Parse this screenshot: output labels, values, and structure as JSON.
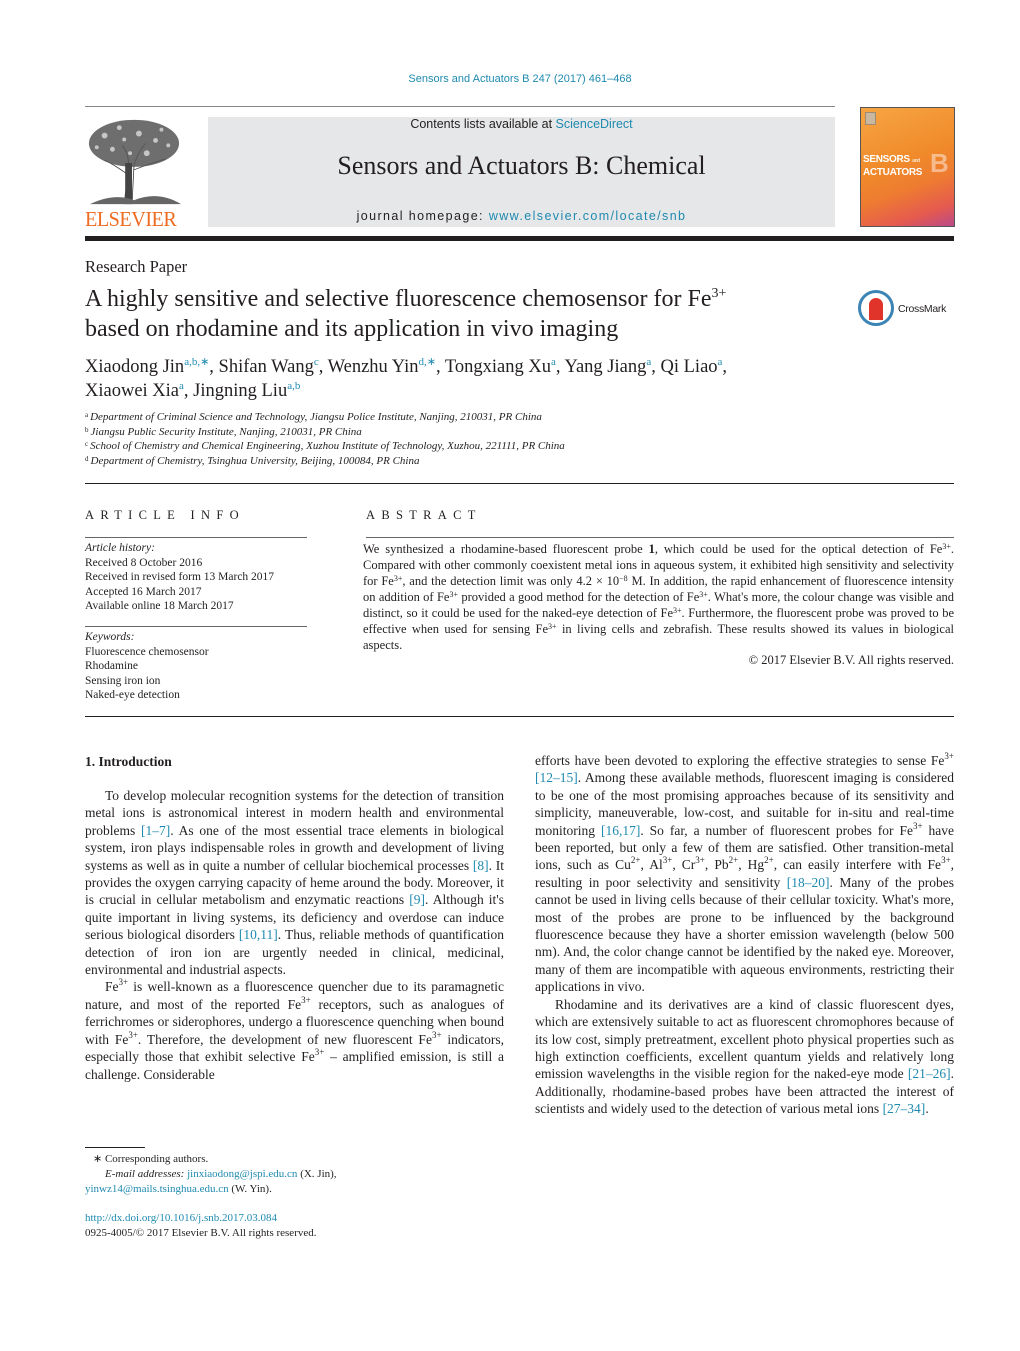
{
  "header": {
    "citation": "Sensors and Actuators B 247 (2017) 461–468",
    "contents_prefix": "Contents lists available at ",
    "contents_link": "ScienceDirect",
    "journal_name": "Sensors and Actuators B: Chemical",
    "homepage_prefix": "journal homepage: ",
    "homepage_link": "www.elsevier.com/locate/snb",
    "publisher_logo_text": "ELSEVIER",
    "cover": {
      "line1": "SENSORS",
      "and": "and",
      "line2": "ACTUATORS",
      "letter": "B"
    },
    "brand_color": "#f06b22",
    "link_color": "#1f8ab0"
  },
  "article": {
    "type": "Research Paper",
    "title_line1": "A highly sensitive and selective fluorescence chemosensor for Fe",
    "title_sup": "3+",
    "title_line2": "based on rhodamine and its application in vivo imaging",
    "crossmark_label": "CrossMark",
    "authors": [
      {
        "name": "Xiaodong Jin",
        "sup": "a,b,∗",
        "sep": ", "
      },
      {
        "name": "Shifan Wang",
        "sup": "c",
        "sep": ", "
      },
      {
        "name": "Wenzhu Yin",
        "sup": "d,∗",
        "sep": ", "
      },
      {
        "name": "Tongxiang Xu",
        "sup": "a",
        "sep": ", "
      },
      {
        "name": "Yang Jiang",
        "sup": "a",
        "sep": ", "
      },
      {
        "name": "Qi Liao",
        "sup": "a",
        "sep": ","
      },
      {
        "name": "Xiaowei Xia",
        "sup": "a",
        "sep": ", "
      },
      {
        "name": "Jingning Liu",
        "sup": "a,b",
        "sep": ""
      }
    ],
    "affiliations": [
      {
        "key": "a",
        "text": "Department of Criminal Science and Technology, Jiangsu Police Institute, Nanjing, 210031, PR China"
      },
      {
        "key": "b",
        "text": "Jiangsu Public Security Institute, Nanjing, 210031, PR China"
      },
      {
        "key": "c",
        "text": "School of Chemistry and Chemical Engineering, Xuzhou Institute of Technology, Xuzhou, 221111, PR China"
      },
      {
        "key": "d",
        "text": "Department of Chemistry, Tsinghua University, Beijing, 100084, PR China"
      }
    ]
  },
  "article_info": {
    "heading": "ARTICLE INFO",
    "history_label": "Article history:",
    "history": [
      "Received 8 October 2016",
      "Received in revised form 13 March 2017",
      "Accepted 16 March 2017",
      "Available online 18 March 2017"
    ],
    "keywords_label": "Keywords:",
    "keywords": [
      "Fluorescence chemosensor",
      "Rhodamine",
      "Sensing iron ion",
      "Naked-eye detection"
    ]
  },
  "abstract": {
    "heading": "ABSTRACT",
    "segments": [
      {
        "t": "We synthesized a rhodamine-based fluorescent probe "
      },
      {
        "t": "1",
        "b": true
      },
      {
        "t": ", which could be used for the optical detection of Fe"
      },
      {
        "t": "3+",
        "sup": true
      },
      {
        "t": ". Compared with other commonly coexistent metal ions in aqueous system, it exhibited high sensitivity and selectivity for Fe"
      },
      {
        "t": "3+",
        "sup": true
      },
      {
        "t": ", and the detection limit was only 4.2 × 10"
      },
      {
        "t": "−8",
        "sup": true
      },
      {
        "t": " M. In addition, the rapid enhancement of fluorescence intensity on addition of Fe"
      },
      {
        "t": "3+",
        "sup": true
      },
      {
        "t": " provided a good method for the detection of Fe"
      },
      {
        "t": "3+",
        "sup": true
      },
      {
        "t": ". What's more, the colour change was visible and distinct, so it could be used for the naked-eye detection of Fe"
      },
      {
        "t": "3+",
        "sup": true
      },
      {
        "t": ". Furthermore, the fluorescent probe was proved to be effective when used for sensing Fe"
      },
      {
        "t": "3+",
        "sup": true
      },
      {
        "t": " in living cells and zebrafish. These results showed its values in biological aspects."
      }
    ],
    "copyright": "© 2017 Elsevier B.V. All rights reserved."
  },
  "body": {
    "intro_heading": "1.  Introduction",
    "left_paragraphs": [
      [
        {
          "t": "To develop molecular recognition systems for the detection of transition metal ions is astronomical interest in modern health and environmental problems "
        },
        {
          "t": "[1–7]",
          "link": true
        },
        {
          "t": ". As one of the most essential trace elements in biological system, iron plays indispensable roles in growth and development of living systems as well as in quite a number of cellular biochemical processes "
        },
        {
          "t": "[8]",
          "link": true
        },
        {
          "t": ". It provides the oxygen carrying capacity of heme around the body. Moreover, it is crucial in cellular metabolism and enzymatic reactions "
        },
        {
          "t": "[9]",
          "link": true
        },
        {
          "t": ". Although it's quite important in living systems, its deficiency and overdose can induce serious biological disorders "
        },
        {
          "t": "[10,11]",
          "link": true
        },
        {
          "t": ". Thus, reliable methods of quantification detection of iron ion are urgently needed in clinical, medicinal, environmental and industrial aspects."
        }
      ],
      [
        {
          "t": "Fe"
        },
        {
          "t": "3+",
          "sup": true
        },
        {
          "t": " is well-known as a fluorescence quencher due to its paramagnetic nature, and most of the reported Fe"
        },
        {
          "t": "3+",
          "sup": true
        },
        {
          "t": " receptors, such as analogues of ferrichromes or siderophores, undergo a fluorescence quenching when bound with Fe"
        },
        {
          "t": "3+",
          "sup": true
        },
        {
          "t": ". Therefore, the development of new fluorescent Fe"
        },
        {
          "t": "3+",
          "sup": true
        },
        {
          "t": " indicators, especially those that exhibit selective Fe"
        },
        {
          "t": "3+",
          "sup": true
        },
        {
          "t": " – amplified emission, is still a challenge. Considerable"
        }
      ]
    ],
    "right_paragraphs": [
      [
        {
          "t": "efforts have been devoted to exploring the effective strategies to sense Fe"
        },
        {
          "t": "3+",
          "sup": true
        },
        {
          "t": " "
        },
        {
          "t": "[12–15]",
          "link": true
        },
        {
          "t": ". Among these available methods, fluorescent imaging is considered to be one of the most promising approaches because of its sensitivity and simplicity, maneuverable, low-cost, and suitable for in-situ and real-time monitoring "
        },
        {
          "t": "[16,17]",
          "link": true
        },
        {
          "t": ". So far, a number of fluorescent probes for Fe"
        },
        {
          "t": "3+",
          "sup": true
        },
        {
          "t": " have been reported, but only a few of them are satisfied. Other transition-metal ions, such as Cu"
        },
        {
          "t": "2+",
          "sup": true
        },
        {
          "t": ", Al"
        },
        {
          "t": "3+",
          "sup": true
        },
        {
          "t": ", Cr"
        },
        {
          "t": "3+",
          "sup": true
        },
        {
          "t": ", Pb"
        },
        {
          "t": "2+",
          "sup": true
        },
        {
          "t": ", Hg"
        },
        {
          "t": "2+",
          "sup": true
        },
        {
          "t": ", can easily interfere with Fe"
        },
        {
          "t": "3+",
          "sup": true
        },
        {
          "t": ", resulting in poor selectivity and sensitivity "
        },
        {
          "t": "[18–20]",
          "link": true
        },
        {
          "t": ". Many of the probes cannot be used in living cells because of their cellular toxicity. What's more, most of the probes are prone to be influenced by the background fluorescence because they have a shorter emission wavelength (below 500 nm). And, the color change cannot be identified by the naked eye. Moreover, many of them are incompatible with aqueous environments, restricting their applications in vivo."
        }
      ],
      [
        {
          "t": "Rhodamine and its derivatives are a kind of classic fluorescent dyes, which are extensively suitable to act as fluorescent chromophores because of its low cost, simply pretreatment, excellent photo physical properties such as high extinction coefficients, excellent quantum yields and relatively long emission wavelengths in the visible region for the naked-eye mode "
        },
        {
          "t": "[21–26]",
          "link": true
        },
        {
          "t": ". Additionally, rhodamine-based probes have been attracted the interest of scientists and widely used to the detection of various metal ions "
        },
        {
          "t": "[27–34]",
          "link": true
        },
        {
          "t": "."
        }
      ]
    ]
  },
  "footnotes": {
    "corresponding": "∗  Corresponding authors.",
    "email_label": "E-mail addresses:",
    "email1": "jinxiaodong@jspi.edu.cn",
    "email1_owner": " (X. Jin),",
    "email2": "yinwz14@mails.tsinghua.edu.cn",
    "email2_owner": " (W. Yin).",
    "doi": "http://dx.doi.org/10.1016/j.snb.2017.03.084",
    "issn_copyright": "0925-4005/© 2017 Elsevier B.V. All rights reserved."
  }
}
